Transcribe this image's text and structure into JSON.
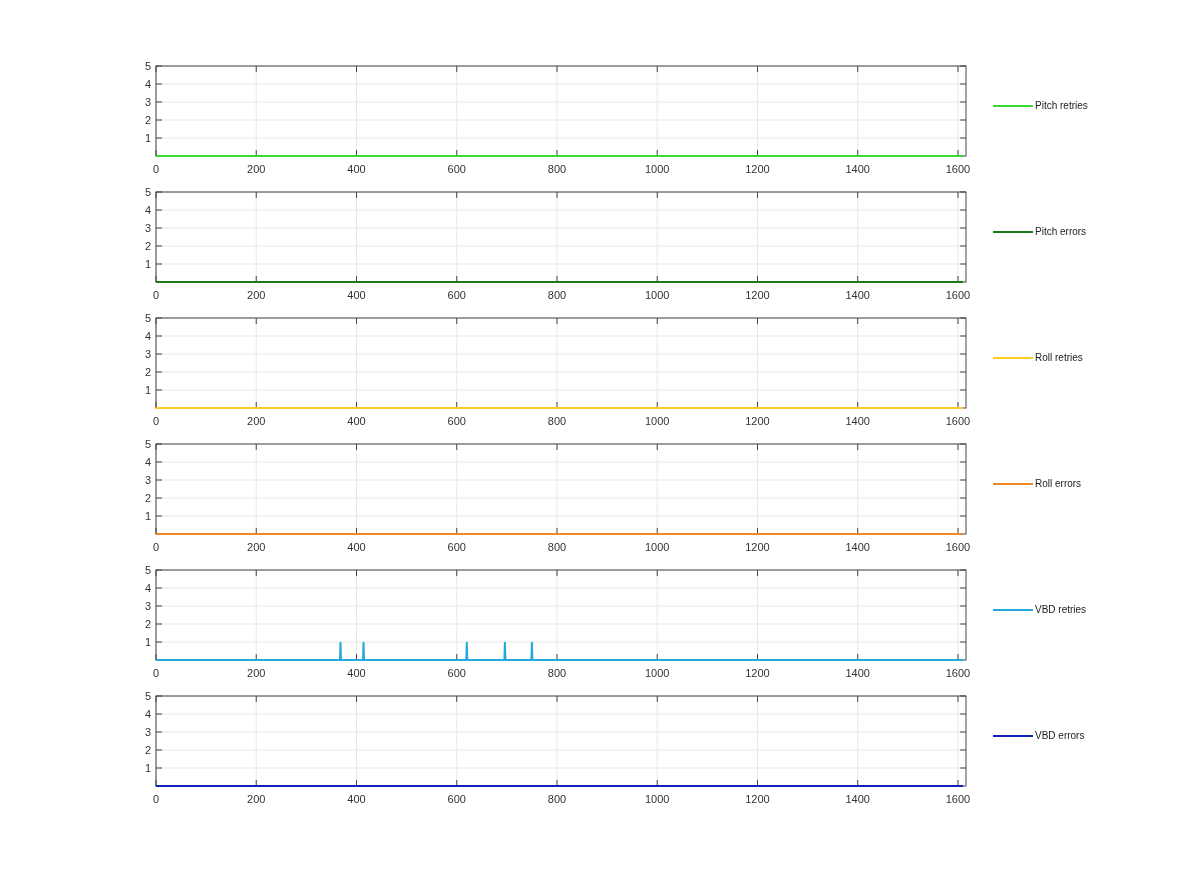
{
  "figure": {
    "plots": [
      {
        "chart_data": {
          "type": "line",
          "x": [
            0,
            1610
          ],
          "grid": true,
          "series": [
            {
              "name": "Pitch retries",
              "color": "#33dd33",
              "values": [
                0,
                0
              ]
            }
          ],
          "xlim": [
            0,
            1616
          ],
          "ylim": [
            0,
            5
          ],
          "xticks": [
            0,
            200,
            400,
            600,
            800,
            1000,
            1200,
            1400,
            1600
          ],
          "yticks": [
            1,
            2,
            3,
            4,
            5
          ]
        }
      },
      {
        "chart_data": {
          "type": "line",
          "x": [
            0,
            1610
          ],
          "grid": true,
          "series": [
            {
              "name": "Pitch errors",
              "color": "#1a7a1a",
              "values": [
                0,
                0
              ]
            }
          ],
          "xlim": [
            0,
            1616
          ],
          "ylim": [
            0,
            5
          ],
          "xticks": [
            0,
            200,
            400,
            600,
            800,
            1000,
            1200,
            1400,
            1600
          ],
          "yticks": [
            1,
            2,
            3,
            4,
            5
          ]
        }
      },
      {
        "chart_data": {
          "type": "line",
          "x": [
            0,
            1610
          ],
          "grid": true,
          "series": [
            {
              "name": "Roll retries",
              "color": "#ffcc22",
              "values": [
                0,
                0
              ]
            }
          ],
          "xlim": [
            0,
            1616
          ],
          "ylim": [
            0,
            5
          ],
          "xticks": [
            0,
            200,
            400,
            600,
            800,
            1000,
            1200,
            1400,
            1600
          ],
          "yticks": [
            1,
            2,
            3,
            4,
            5
          ]
        }
      },
      {
        "chart_data": {
          "type": "line",
          "x": [
            0,
            1610
          ],
          "grid": true,
          "series": [
            {
              "name": "Roll errors",
              "color": "#ee8822",
              "values": [
                0,
                0
              ]
            }
          ],
          "xlim": [
            0,
            1616
          ],
          "ylim": [
            0,
            5
          ],
          "xticks": [
            0,
            200,
            400,
            600,
            800,
            1000,
            1200,
            1400,
            1600
          ],
          "yticks": [
            1,
            2,
            3,
            4,
            5
          ]
        }
      },
      {
        "chart_data": {
          "type": "line",
          "x": [
            0,
            367,
            368,
            369,
            413,
            414,
            415,
            619,
            620,
            621,
            695,
            696,
            697,
            749,
            750,
            751,
            1610
          ],
          "grid": true,
          "series": [
            {
              "name": "VBD retries",
              "color": "#22aadd",
              "values": [
                0,
                0,
                1,
                0,
                0,
                1,
                0,
                0,
                1,
                0,
                0,
                1,
                0,
                0,
                1,
                0,
                0
              ]
            }
          ],
          "xlim": [
            0,
            1616
          ],
          "ylim": [
            0,
            5
          ],
          "xticks": [
            0,
            200,
            400,
            600,
            800,
            1000,
            1200,
            1400,
            1600
          ],
          "yticks": [
            1,
            2,
            3,
            4,
            5
          ]
        }
      },
      {
        "chart_data": {
          "type": "line",
          "x": [
            0,
            1610
          ],
          "grid": true,
          "series": [
            {
              "name": "VBD errors",
              "color": "#1122bb",
              "values": [
                0,
                0
              ]
            }
          ],
          "xlim": [
            0,
            1616
          ],
          "ylim": [
            0,
            5
          ],
          "xticks": [
            0,
            200,
            400,
            600,
            800,
            1000,
            1200,
            1400,
            1600
          ],
          "yticks": [
            1,
            2,
            3,
            4,
            5
          ]
        }
      }
    ]
  }
}
